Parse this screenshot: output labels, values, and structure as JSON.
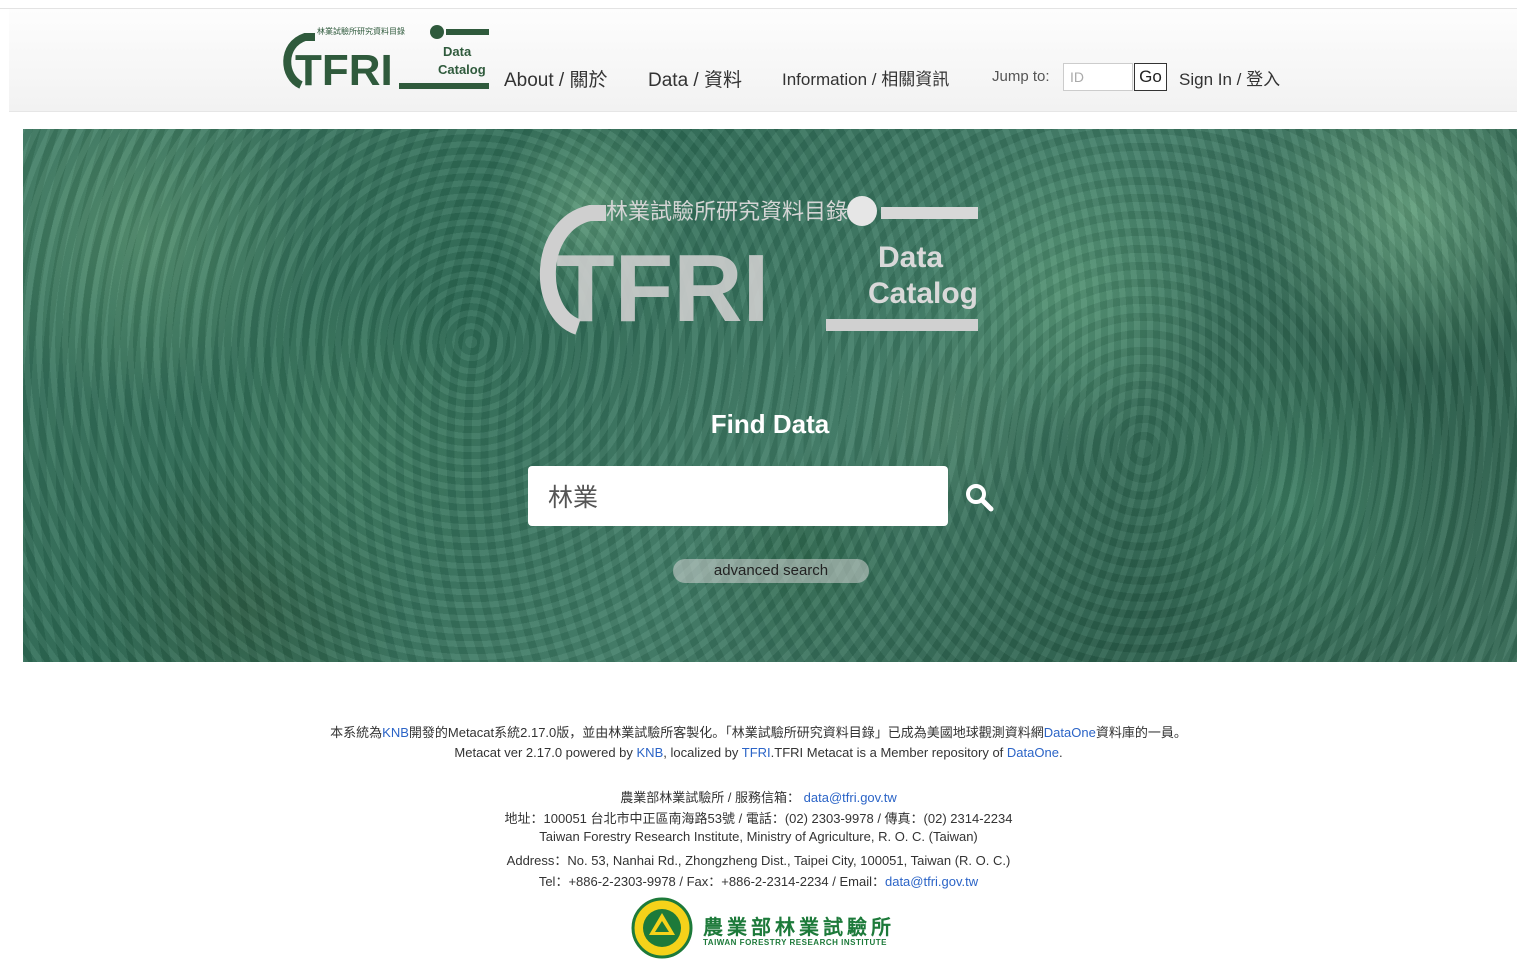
{
  "header": {
    "logo": {
      "seal_text": "林業試驗所研究資料目錄",
      "mark": "TFRI",
      "sub1": "Data",
      "sub2": "Catalog"
    },
    "nav": {
      "about": "About / 關於",
      "data": "Data / 資料",
      "information": "Information / 相關資訊",
      "jump_label": "Jump to:",
      "jump_placeholder": "ID",
      "go_label": "Go",
      "signin": "Sign In / 登入"
    }
  },
  "hero": {
    "logo": {
      "seal_text": "林業試驗所研究資料目錄",
      "mark": "TFRI",
      "sub1": "Data",
      "sub2": "Catalog"
    },
    "find_title": "Find Data",
    "search_value": "林業",
    "search_icon": "search-icon",
    "advanced_search": "advanced search"
  },
  "footer": {
    "line1_pre": "本系統為",
    "knb_link": "KNB",
    "line1_mid1": "開發的Metacat系統2.17.0版，並由林業試驗所客製化。「林業試驗所研究資料目錄」已成為美國地球觀測資料網",
    "dataone_link": "DataOne",
    "line1_post": "資料庫的一員。",
    "line2_pre": "Metacat ver 2.17.0 powered by ",
    "line2_knb": "KNB",
    "line2_mid": ", localized by ",
    "line2_tfri": "TFRI",
    "line2_mid2": ".TFRI Metacat is a Member repository of ",
    "line2_dataone": "DataOne",
    "line2_end": ".",
    "line3_pre": "農業部林業試驗所 / 服務信箱： ",
    "line3_email": "data@tfri.gov.tw",
    "line4": "地址：100051 台北市中正區南海路53號 / 電話：(02) 2303-9978 / 傳真：(02) 2314-2234",
    "line5": "Taiwan Forestry Research Institute, Ministry of Agriculture, R. O. C. (Taiwan)",
    "line6": "Address：No. 53, Nanhai Rd., Zhongzheng Dist., Taipei City, 100051, Taiwan (R. O. C.)",
    "line7_pre": "Tel：+886-2-2303-9978 / Fax：+886-2-2314-2234 / Email：",
    "line7_email": "data@tfri.gov.tw",
    "inst_name_zh": "農業部林業試驗所",
    "inst_name_en": "TAIWAN FORESTRY RESEARCH INSTITUTE"
  },
  "colors": {
    "brand_green": "#2f5a3c",
    "link_blue": "#2b64c7",
    "hero_green": "#3d7a63"
  }
}
